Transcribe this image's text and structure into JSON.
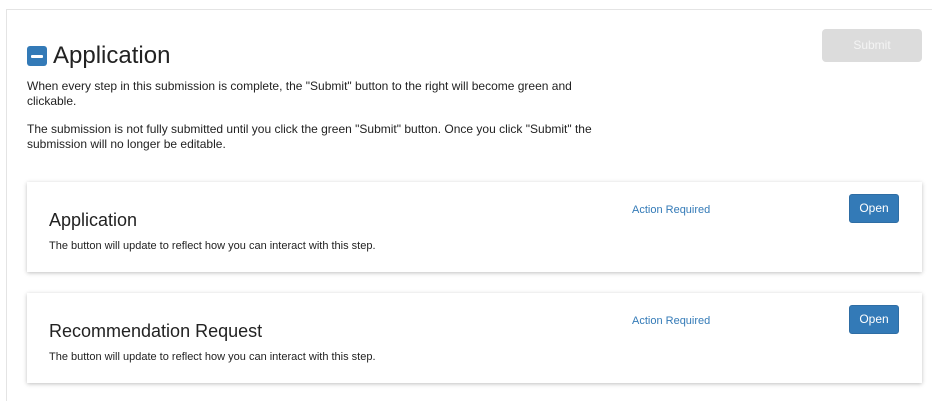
{
  "header": {
    "title": "Application",
    "collapse_icon": "minus-square-icon"
  },
  "description": {
    "line1": "When every step in this submission is complete, the \"Submit\" button to the right will become green and clickable.",
    "line2": "The submission is not fully submitted until you click the green \"Submit\" button. Once you click \"Submit\" the submission will no longer be editable."
  },
  "submit_button": {
    "label": "Submit",
    "state": "disabled"
  },
  "steps": [
    {
      "title": "Application",
      "description": "The button will update to reflect how you can interact with this step.",
      "status": "Action Required",
      "button_label": "Open"
    },
    {
      "title": "Recommendation Request",
      "description": "The button will update to reflect how you can interact with this step.",
      "status": "Action Required",
      "button_label": "Open"
    }
  ],
  "colors": {
    "accent": "#337ab7",
    "disabled_button": "#dcdcdc"
  }
}
